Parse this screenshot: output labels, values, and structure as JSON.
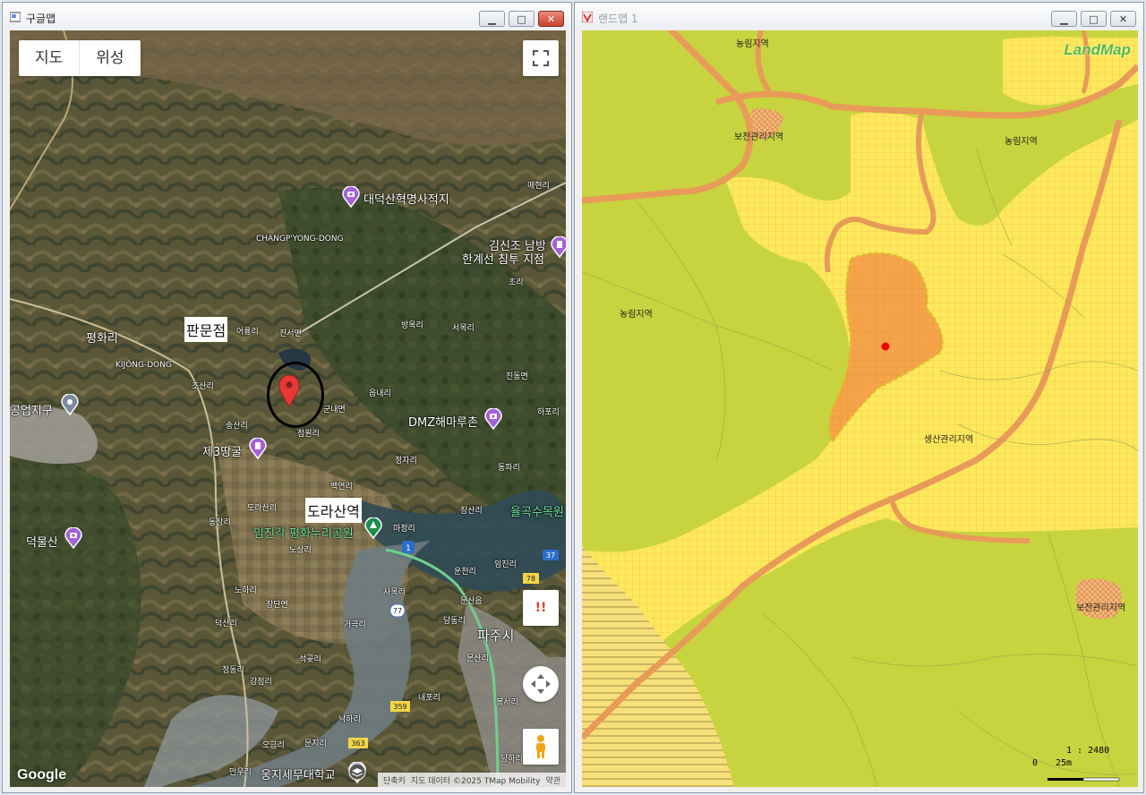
{
  "google_window": {
    "title": "구글맵",
    "map_type_buttons": [
      "지도",
      "위성"
    ],
    "labels": {
      "daedeok": "대덕산혁명사적지",
      "changpyong": "CHANGP'YONG-DONG",
      "kimsinjo_1": "김신조 남방",
      "kimsinjo_2": "한계선 침투 지점",
      "pyeonghwa": "평화리",
      "kijong": "KIJŎNG-DONG",
      "industrial": "공업지구",
      "dmz": "DMZ해마루촌",
      "tunnel3": "제3땅굴",
      "imjingak": "임진각 평화누리공원",
      "yulgok": "율곡수목원",
      "deokmulsan": "덕물산",
      "paju": "파주시",
      "ungji": "웅지세무대학교",
      "maehyeon": "매현리",
      "cho": "초리",
      "bangmok": "방목리",
      "seomok": "서목리",
      "eoryong": "어룡리",
      "jinseo": "진서면",
      "josan": "조산리",
      "gunnae": "군내면",
      "eumnae": "읍내리",
      "jindong": "진동면",
      "hapo": "하포리",
      "songsan": "송산리",
      "jeomwon": "점원리",
      "jeongja": "정자리",
      "dongpa": "동파리",
      "baegyeon": "백연리",
      "dorasan_ri": "도라산리",
      "majeong": "마정리",
      "jangsan": "장산리",
      "dongjang": "동장리",
      "nosang": "노상리",
      "imjin": "임진리",
      "uncheon": "운천리",
      "noha": "노하리",
      "sagok": "사목리",
      "munsaneup": "문산읍",
      "jangdan": "장단면",
      "deoksan": "덕산리",
      "danggok": "당동리",
      "geogok": "거곡리",
      "jeongdong": "정동리",
      "gangjeong": "강정리",
      "seokgot": "석곶리",
      "munsan": "문산리",
      "naepo": "내포리",
      "bongseo": "봉서리",
      "nakha": "낙하리",
      "ogeum": "오금리",
      "munji": "문지리",
      "manu": "만우리",
      "dangha": "당하리"
    },
    "road_badges": [
      "1",
      "37",
      "78",
      "77",
      "359",
      "363"
    ],
    "overlay_labels": {
      "panmunjeom": "판문점",
      "dorasan": "도라산역"
    },
    "alert_button": "!!",
    "logo": "Google",
    "attribution": [
      "단축키",
      "지도 데이터 ©2025 TMap Mobility",
      "약관"
    ]
  },
  "land_window": {
    "title": "랜드맵 1",
    "logo": "LandMap",
    "zone_labels": {
      "top": "농림지역",
      "conservation_top": "보전관리지역",
      "agri_right": "농림지역",
      "agri_left": "농림지역",
      "production": "생산관리지역",
      "conservation_right": "보전관리지역"
    },
    "scale": {
      "ratio": "1 : 2480",
      "zero": "0",
      "distance": "25m"
    }
  },
  "colors": {
    "agri_green": "#c8d43f",
    "production_yellow": "#fde95c",
    "parcel_orange": "#f6a44a",
    "road_orange": "#e89a58",
    "pin_red": "#e53935",
    "poi_purple": "#a362d6"
  }
}
